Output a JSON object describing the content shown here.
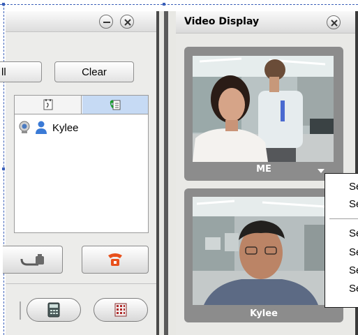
{
  "left_panel": {
    "buttons": {
      "partial_label": "ll",
      "clear_label": "Clear"
    },
    "contact_list": {
      "contacts": [
        {
          "name": "Kylee"
        }
      ]
    }
  },
  "video_panel": {
    "title": "Video Display",
    "tiles": [
      {
        "label": "ME"
      },
      {
        "label": "Kylee"
      }
    ]
  },
  "context_menu": {
    "items": [
      "Se",
      "Se",
      "Se",
      "Se",
      "Se",
      "Se"
    ]
  },
  "colors": {
    "accent_blue": "#3a5fb8",
    "call_red": "#e8501c",
    "tab_active": "#c6daf4"
  }
}
